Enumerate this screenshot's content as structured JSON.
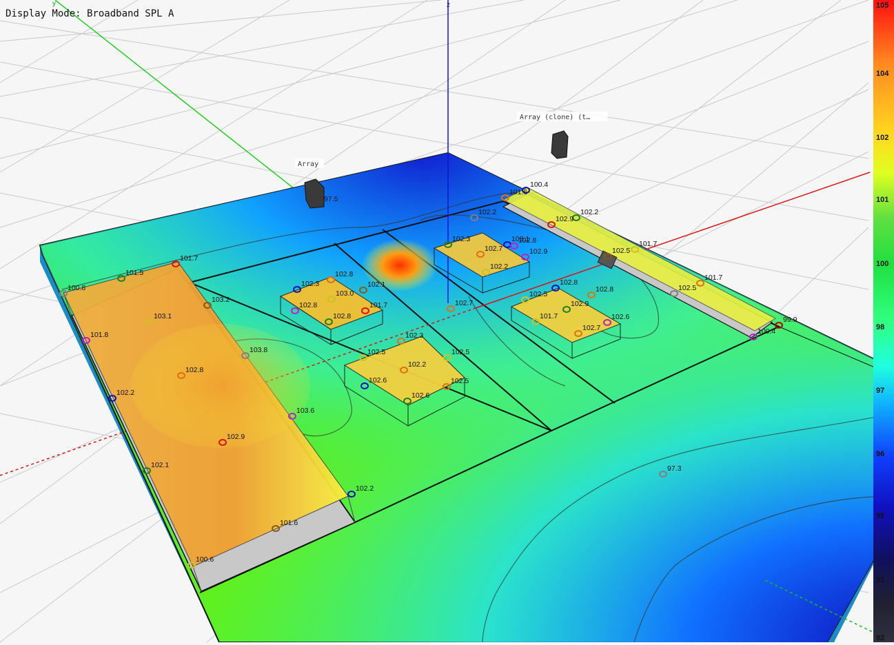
{
  "display_mode": "Display Mode: Broadband SPL A",
  "axes": {
    "z": "z",
    "y": "y"
  },
  "colorbar": {
    "ticks": [
      "105",
      "104",
      "102",
      "101",
      "100",
      "98",
      "97",
      "96",
      "95",
      "93",
      "92"
    ]
  },
  "sources": [
    {
      "label": "Array",
      "value": "97.5"
    },
    {
      "label": "Array (clone) (t…"
    }
  ],
  "measurement_points": [
    "100.4",
    "101.6",
    "102.2",
    "102.9",
    "101.7",
    "102.5",
    "101.7",
    "102.5",
    "99.9",
    "100.4",
    "102.2",
    "102.3",
    "103.1",
    "102.8",
    "102.7",
    "102.9",
    "102.2",
    "102.7",
    "102.8",
    "102.5",
    "102.9",
    "102.8",
    "101.7",
    "102.7",
    "102.6",
    "101.7",
    "101.5",
    "100.8",
    "103.2",
    "103.1",
    "101.8",
    "103.8",
    "102.8",
    "102.2",
    "103.6",
    "102.9",
    "102.1",
    "102.2",
    "101.6",
    "100.6",
    "102.3",
    "102.8",
    "102.1",
    "103.0",
    "102.8",
    "101.7",
    "102.8",
    "102.3",
    "102.5",
    "102.5",
    "102.2",
    "102.6",
    "102.5",
    "102.6",
    "97.3"
  ]
}
